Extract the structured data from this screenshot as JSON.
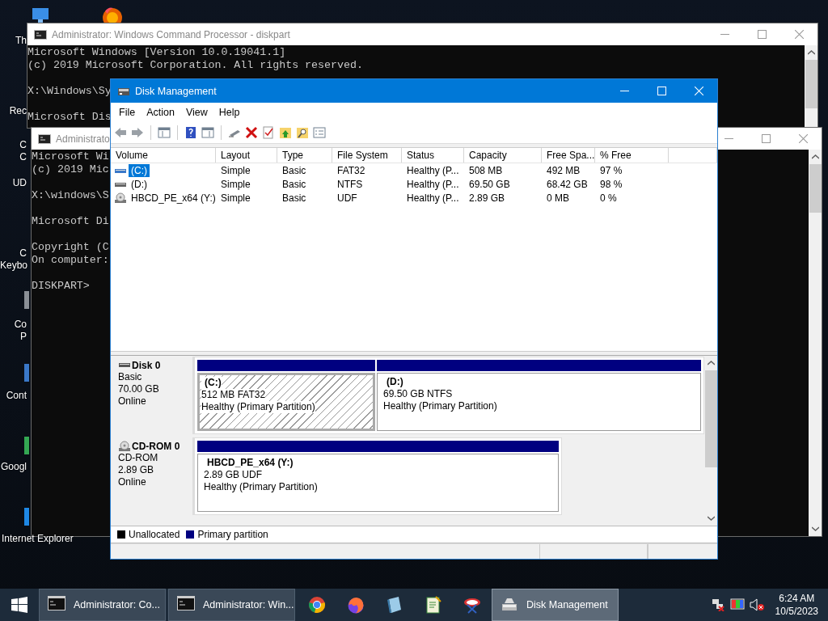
{
  "desktop": {
    "icons": [
      {
        "lines": [
          "Th"
        ]
      },
      {
        "lines": [
          "Rec"
        ]
      },
      {
        "lines": [
          "C",
          "C"
        ]
      },
      {
        "lines": [
          "UD"
        ]
      },
      {
        "lines": [
          "C",
          "Keybo"
        ]
      },
      {
        "lines": [
          "Co",
          "P"
        ]
      },
      {
        "lines": [
          "Cont"
        ]
      },
      {
        "lines": [
          "Googl"
        ]
      },
      {
        "lines": [
          "Internet Explorer"
        ]
      }
    ]
  },
  "cmd_windows": [
    {
      "title": "Administrator: Windows Command Processor - diskpart",
      "paragraphs": [
        [
          "Microsoft Windows [Version 10.0.19041.1]",
          "(c) 2019 Microsoft Corporation. All rights reserved."
        ],
        [
          "X:\\Windows\\Sy"
        ],
        [
          "Microsoft Dis"
        ]
      ]
    },
    {
      "title": "Administrato",
      "paragraphs": [
        [
          "Microsoft Wi",
          "(c) 2019 Mic"
        ],
        [
          "X:\\windows\\S"
        ],
        [
          "Microsoft Di"
        ],
        [
          "Copyright (C",
          "On computer:"
        ],
        [
          "DISKPART>"
        ]
      ]
    }
  ],
  "disk_management": {
    "title": "Disk Management",
    "menu": [
      "File",
      "Action",
      "View",
      "Help"
    ],
    "volume_list": {
      "columns": [
        "Volume",
        "Layout",
        "Type",
        "File System",
        "Status",
        "Capacity",
        "Free Spa...",
        "% Free"
      ],
      "rows": [
        {
          "kind": "disk",
          "selected": true,
          "cells": [
            "(C:)",
            "Simple",
            "Basic",
            "FAT32",
            "Healthy (P...",
            "508 MB",
            "492 MB",
            "97 %"
          ]
        },
        {
          "kind": "disk",
          "selected": false,
          "cells": [
            "(D:)",
            "Simple",
            "Basic",
            "NTFS",
            "Healthy (P...",
            "69.50 GB",
            "68.42 GB",
            "98 %"
          ]
        },
        {
          "kind": "cdrom",
          "selected": false,
          "cells": [
            "HBCD_PE_x64 (Y:)",
            "Simple",
            "Basic",
            "UDF",
            "Healthy (P...",
            "2.89 GB",
            "0 MB",
            "0 %"
          ]
        }
      ]
    },
    "disks": [
      {
        "name": "Disk 0",
        "kind": "disk",
        "type": "Basic",
        "size": "70.00 GB",
        "status": "Online",
        "partitions": [
          {
            "name": "(C:)",
            "info": "512 MB FAT32",
            "status": "Healthy (Primary Partition)",
            "selected": true
          },
          {
            "name": "(D:)",
            "info": "69.50 GB NTFS",
            "status": "Healthy (Primary Partition)",
            "selected": false
          }
        ]
      },
      {
        "name": "CD-ROM 0",
        "kind": "cdrom",
        "type": "CD-ROM",
        "size": "2.89 GB",
        "status": "Online",
        "partitions": [
          {
            "name": "HBCD_PE_x64  (Y:)",
            "info": "2.89 GB UDF",
            "status": "Healthy (Primary Partition)",
            "selected": false
          }
        ]
      }
    ],
    "legend": [
      {
        "label": "Unallocated",
        "color": "#000000"
      },
      {
        "label": "Primary partition",
        "color": "#000080"
      }
    ]
  },
  "taskbar": {
    "items": [
      {
        "kind": "cmd",
        "label": "Administrator: Co...",
        "selected": false
      },
      {
        "kind": "cmd",
        "label": "Administrator: Win...",
        "selected": false
      },
      {
        "kind": "ring"
      },
      {
        "kind": "flame"
      },
      {
        "kind": "notepad"
      },
      {
        "kind": "editor"
      },
      {
        "kind": "tool"
      },
      {
        "kind": "disk",
        "label": "Disk Management",
        "selected": true
      }
    ],
    "time": "6:24 AM",
    "date": "10/5/2023"
  }
}
